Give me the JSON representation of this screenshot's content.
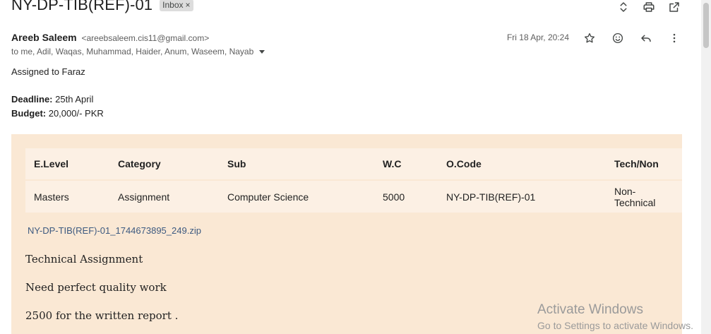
{
  "email": {
    "subject": "NY-DP-TIB(REF)-01",
    "label": "Inbox",
    "label_remove": "×",
    "sender_name": "Areeb Saleem",
    "sender_email": "<areebsaleem.cis11@gmail.com>",
    "recipients": "to me, Adil, Waqas, Muhammad, Haider, Anum, Waseem, Nayab",
    "date": "Fri 18 Apr, 20:24"
  },
  "body": {
    "assigned": "Assigned to Faraz",
    "deadline_label": "Deadline:",
    "deadline_value": " 25th April",
    "budget_label": "Budget:",
    "budget_value": " 20,000/- PKR"
  },
  "table": {
    "headers": [
      "E.Level",
      "Category",
      "Sub",
      "W.C",
      "O.Code",
      "Tech/Non"
    ],
    "rows": [
      [
        "Masters",
        "Assignment",
        "Computer Science",
        "5000",
        "NY-DP-TIB(REF)-01",
        "Non-Technical"
      ]
    ]
  },
  "attachment": "NY-DP-TIB(REF)-01_1744673895_249.zip",
  "notes": [
    "Technical Assignment",
    "Need perfect quality work",
    "2500 for the written report ."
  ],
  "watermark": {
    "title": "Activate Windows",
    "subtitle": "Go to Settings to activate Windows."
  },
  "icons": {
    "top": [
      "expand-collapse-icon",
      "print-icon",
      "open-new-window-icon"
    ],
    "message": [
      "star-icon",
      "emoji-react-icon",
      "reply-icon",
      "more-options-icon"
    ]
  }
}
